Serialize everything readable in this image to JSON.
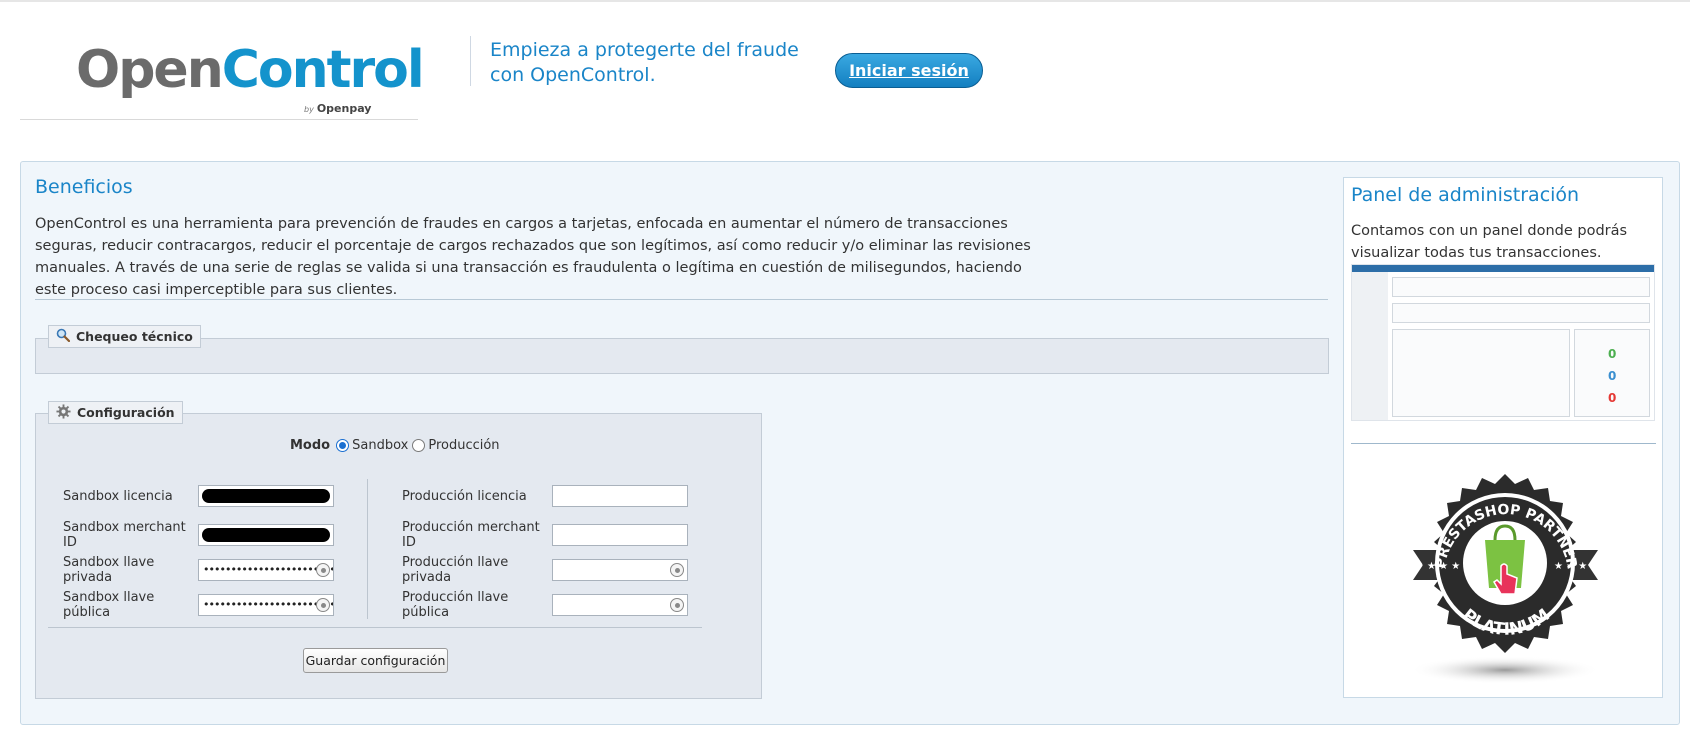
{
  "header": {
    "logo": {
      "open": "Open",
      "control": "Control",
      "by": "by",
      "brand": "Openpay"
    },
    "tagline": "Empieza a protegerte del fraude con OpenControl.",
    "login_button": "Iniciar sesión"
  },
  "benefits": {
    "title": "Beneficios",
    "text": "OpenControl es una herramienta para prevención de fraudes en cargos a tarjetas, enfocada en aumentar el número de transacciones seguras, reducir contracargos, reducir el porcentaje de cargos rechazados que son legítimos, así como reducir y/o eliminar las revisiones manuales. A través de una serie de reglas se valida si una transacción es fraudulenta o legítima en cuestión de milisegundos, haciendo este proceso casi imperceptible para sus clientes."
  },
  "tech_check": {
    "legend": "Chequeo técnico",
    "icon": "magnifier-icon"
  },
  "config": {
    "legend": "Configuración",
    "icon": "gear-icon",
    "mode_label": "Modo",
    "mode_options": [
      "Sandbox",
      "Producción"
    ],
    "mode_selected": "Sandbox",
    "sandbox": {
      "license_label": "Sandbox licencia",
      "merchant_label": "Sandbox merchant ID",
      "private_key_label": "Sandbox llave privada",
      "private_key_value": "••••••••••••••••••••••••••••••",
      "public_key_label": "Sandbox llave pública",
      "public_key_value": "••••••••••••••••••••••••••••••"
    },
    "production": {
      "license_label": "Producción licencia",
      "merchant_label": "Producción merchant ID",
      "private_key_label": "Producción llave privada",
      "public_key_label": "Producción llave pública"
    },
    "save_button": "Guardar configuración"
  },
  "admin_panel": {
    "title": "Panel de administración",
    "text": "Contamos con un panel donde podrás visualizar todas tus transacciones.",
    "dashboard_counts": [
      "0",
      "0",
      "0"
    ]
  },
  "badge": {
    "top_text": "PRESTASHOP PARTNER",
    "bottom_text": "PLATINUM"
  },
  "colors": {
    "accent": "#1a85c8",
    "panel_bg": "#f0f6fb",
    "fieldset_bg": "#e4e9f0"
  }
}
